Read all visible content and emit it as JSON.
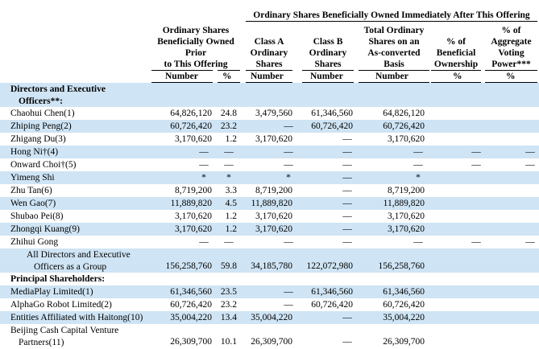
{
  "header": {
    "group_title": "Ordinary Shares Beneficially Owned Immediately After This Offering",
    "prior_lines": [
      "Ordinary Shares",
      "Beneficially Owned",
      "Prior",
      "to This Offering"
    ],
    "class_a_lines": [
      "Class A",
      "Ordinary",
      "Shares"
    ],
    "class_b_lines": [
      "Class B",
      "Ordinary",
      "Shares"
    ],
    "total_lines": [
      "Total Ordinary",
      "Shares on an",
      "As-converted",
      "Basis"
    ],
    "beneficial_lines": [
      "% of",
      "Beneficial",
      "Ownership"
    ],
    "voting_lines": [
      "% of",
      "Aggregate",
      "Voting",
      "Power***"
    ],
    "sub_number": "Number",
    "sub_percent": "%"
  },
  "rows": [
    {
      "type": "section",
      "label": [
        "Directors and Executive",
        "Officers**:"
      ]
    },
    {
      "label": "Chaohui Chen(1)",
      "prior_num": "64,826,120",
      "prior_pct": "24.8",
      "class_a": "3,479,560",
      "class_b": "61,346,560",
      "total": "64,826,120",
      "ben": "",
      "vote": ""
    },
    {
      "label": "Zhiping Peng(2)",
      "prior_num": "60,726,420",
      "prior_pct": "23.2",
      "class_a": "—",
      "class_b": "60,726,420",
      "total": "60,726,420",
      "ben": "",
      "vote": ""
    },
    {
      "label": "Zhigang Du(3)",
      "prior_num": "3,170,620",
      "prior_pct": "1.2",
      "class_a": "3,170,620",
      "class_b": "—",
      "total": "3,170,620",
      "ben": "",
      "vote": ""
    },
    {
      "label": "Hong Ni†(4)",
      "prior_num": "—",
      "prior_pct": "—",
      "class_a": "—",
      "class_b": "—",
      "total": "—",
      "ben": "—",
      "vote": "—"
    },
    {
      "label": "Onward Choi†(5)",
      "prior_num": "—",
      "prior_pct": "—",
      "class_a": "—",
      "class_b": "—",
      "total": "—",
      "ben": "—",
      "vote": "—"
    },
    {
      "label": "Yimeng Shi",
      "prior_num": "*",
      "prior_pct": "*",
      "class_a": "*",
      "class_b": "—",
      "total": "*",
      "ben": "",
      "vote": ""
    },
    {
      "label": "Zhu Tan(6)",
      "prior_num": "8,719,200",
      "prior_pct": "3.3",
      "class_a": "8,719,200",
      "class_b": "—",
      "total": "8,719,200",
      "ben": "",
      "vote": ""
    },
    {
      "label": "Wen Gao(7)",
      "prior_num": "11,889,820",
      "prior_pct": "4.5",
      "class_a": "11,889,820",
      "class_b": "—",
      "total": "11,889,820",
      "ben": "",
      "vote": ""
    },
    {
      "label": "Shubao Pei(8)",
      "prior_num": "3,170,620",
      "prior_pct": "1.2",
      "class_a": "3,170,620",
      "class_b": "—",
      "total": "3,170,620",
      "ben": "",
      "vote": ""
    },
    {
      "label": "Zhongqi Kuang(9)",
      "prior_num": "3,170,620",
      "prior_pct": "1.2",
      "class_a": "3,170,620",
      "class_b": "—",
      "total": "3,170,620",
      "ben": "",
      "vote": ""
    },
    {
      "label": "Zhihui Gong",
      "prior_num": "—",
      "prior_pct": "—",
      "class_a": "—",
      "class_b": "—",
      "total": "—",
      "ben": "—",
      "vote": "—"
    },
    {
      "type": "tall",
      "indent": true,
      "label": [
        "All Directors and Executive",
        "Officers as a Group"
      ],
      "prior_num": "156,258,760",
      "prior_pct": "59.8",
      "class_a": "34,185,780",
      "class_b": "122,072,980",
      "total": "156,258,760",
      "ben": "",
      "vote": ""
    },
    {
      "type": "section",
      "label": [
        "Principal Shareholders:"
      ]
    },
    {
      "label": "MediaPlay Limited(1)",
      "prior_num": "61,346,560",
      "prior_pct": "23.5",
      "class_a": "—",
      "class_b": "61,346,560",
      "total": "61,346,560",
      "ben": "",
      "vote": ""
    },
    {
      "label": "AlphaGo Robot Limited(2)",
      "prior_num": "60,726,420",
      "prior_pct": "23.2",
      "class_a": "—",
      "class_b": "60,726,420",
      "total": "60,726,420",
      "ben": "",
      "vote": ""
    },
    {
      "label": "Entities Affiliated with Haitong(10)",
      "prior_num": "35,004,220",
      "prior_pct": "13.4",
      "class_a": "35,004,220",
      "class_b": "—",
      "total": "35,004,220",
      "ben": "",
      "vote": ""
    },
    {
      "type": "tall",
      "label": [
        "Beijing Cash Capital Venture",
        "Partners(11)"
      ],
      "prior_num": "26,309,700",
      "prior_pct": "10.1",
      "class_a": "26,309,700",
      "class_b": "—",
      "total": "26,309,700",
      "ben": "",
      "vote": ""
    }
  ]
}
